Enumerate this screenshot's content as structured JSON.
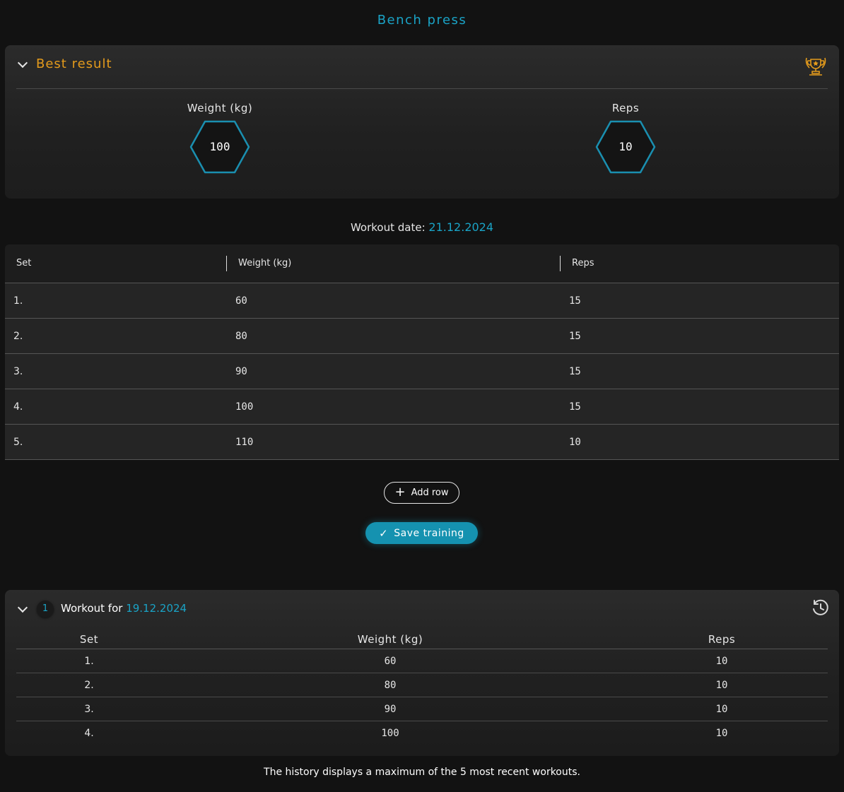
{
  "page_title": "Bench press",
  "best_result": {
    "title": "Best result",
    "weight_label": "Weight (kg)",
    "weight_value": "100",
    "reps_label": "Reps",
    "reps_value": "10",
    "accent_color": "#e49b1c",
    "icon": "trophy-icon"
  },
  "workout": {
    "date_label": "Workout date:",
    "date_value": "21.12.2024",
    "columns": [
      "Set",
      "Weight (kg)",
      "Reps"
    ],
    "rows": [
      {
        "set": "1.",
        "weight": "60",
        "reps": "15"
      },
      {
        "set": "2.",
        "weight": "80",
        "reps": "15"
      },
      {
        "set": "3.",
        "weight": "90",
        "reps": "15"
      },
      {
        "set": "4.",
        "weight": "100",
        "reps": "15"
      },
      {
        "set": "5.",
        "weight": "110",
        "reps": "10"
      }
    ],
    "add_row_label": "Add row",
    "save_label": "Save training"
  },
  "history": {
    "index": "1",
    "title_prefix": "Workout for",
    "date_value": "19.12.2024",
    "columns": [
      "Set",
      "Weight (kg)",
      "Reps"
    ],
    "rows": [
      {
        "set": "1.",
        "weight": "60",
        "reps": "10"
      },
      {
        "set": "2.",
        "weight": "80",
        "reps": "10"
      },
      {
        "set": "3.",
        "weight": "90",
        "reps": "10"
      },
      {
        "set": "4.",
        "weight": "100",
        "reps": "10"
      }
    ],
    "icon": "history-icon",
    "note": "The history displays a maximum of the 5 most recent workouts."
  },
  "colors": {
    "accent": "#1aa3c6",
    "button": "#1592b0",
    "background": "#121212"
  }
}
